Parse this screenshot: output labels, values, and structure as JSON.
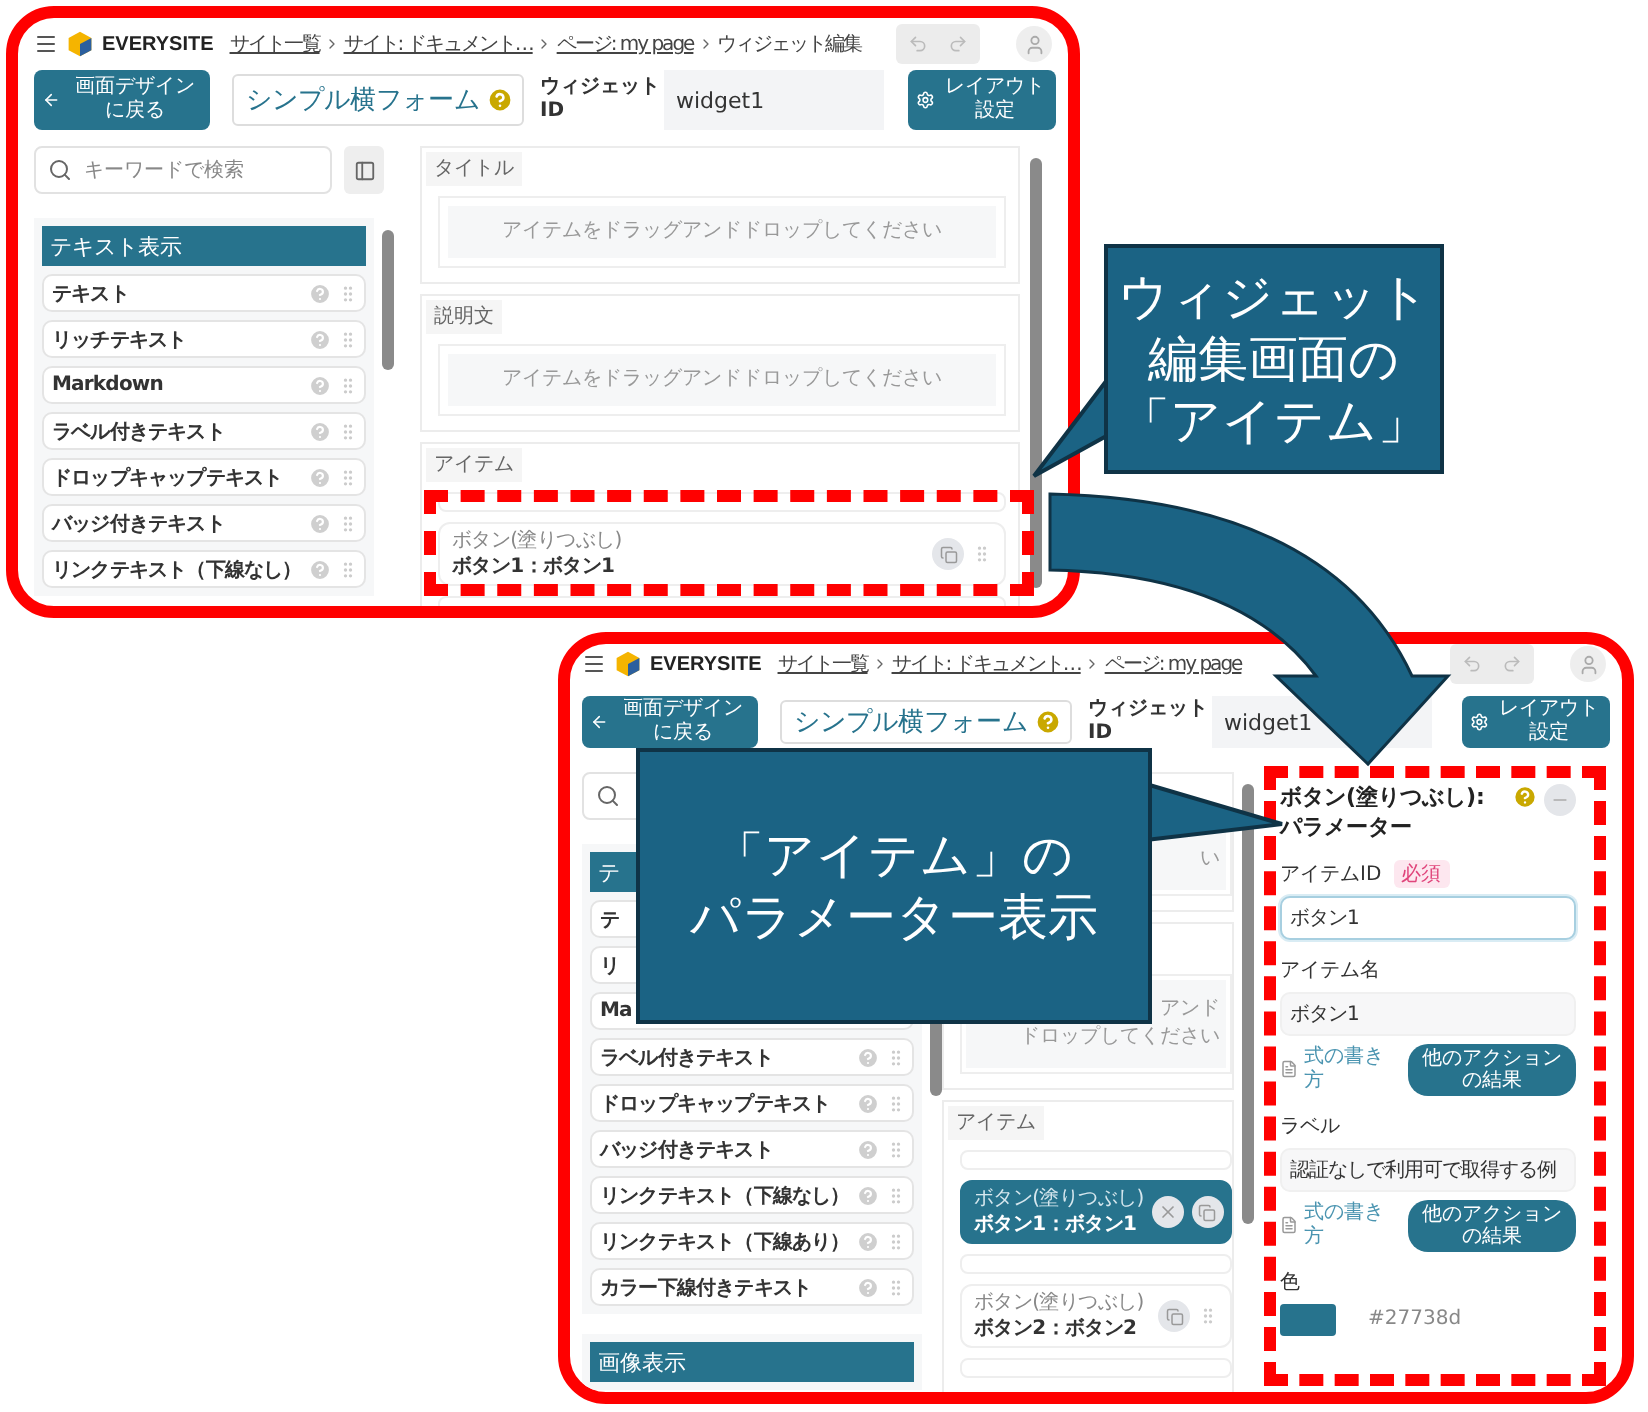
{
  "screens": [
    {
      "header": {
        "logo": "EVERYSITE",
        "breadcrumbs": [
          {
            "label": "サイト一覧",
            "link": true
          },
          {
            "label": "サイト: ドキュメント…",
            "link": true
          },
          {
            "label": "ページ: my page",
            "link": true
          },
          {
            "label": "ウィジェット編集",
            "link": false
          }
        ]
      },
      "toolbar": {
        "back_button": "画面デザインに戻る",
        "title_field": "シンプル横フォーム",
        "widget_id_label": "ウィジェットID",
        "widget_id_value": "widget1",
        "layout_button": "レイアウト設定"
      },
      "sidebar": {
        "search_placeholder": "キーワードで検索",
        "groups": [
          {
            "title": "テキスト表示",
            "items": [
              "テキスト",
              "リッチテキスト",
              "Markdown",
              "ラベル付きテキスト",
              "ドロップキャップテキスト",
              "バッジ付きテキスト",
              "リンクテキスト（下線なし）"
            ]
          }
        ]
      },
      "canvas": {
        "sections": [
          {
            "label": "タイトル",
            "drop_hint_lines": [
              "アイテムをドラッグアンドドロップしてください"
            ]
          },
          {
            "label": "説明文",
            "drop_hint_lines": [
              "アイテムをドラッグアンドドロップしてください"
            ]
          },
          {
            "label": "アイテム",
            "items": [
              {
                "type": "ボタン(塗りつぶし)",
                "name": "ボタン1：ボタン1",
                "selected": false
              }
            ]
          }
        ]
      }
    },
    {
      "header": {
        "logo": "EVERYSITE",
        "breadcrumbs": [
          {
            "label": "サイト一覧",
            "link": true
          },
          {
            "label": "サイト: ドキュメント…",
            "link": true
          },
          {
            "label": "ページ: my page",
            "link": true
          }
        ]
      },
      "toolbar": {
        "back_button": "画面デザインに戻る",
        "title_field": "シンプル横フォーム",
        "widget_id_label": "ウィジェットID",
        "widget_id_value": "widget1",
        "layout_button": "レイアウト設定"
      },
      "sidebar": {
        "groups": [
          {
            "title": "テ",
            "items": [
              "テ",
              "リ",
              "Ma",
              "ラベル付きテキスト",
              "ドロップキャップテキスト",
              "バッジ付きテキスト",
              "リンクテキスト（下線なし）",
              "リンクテキスト（下線あり）",
              "カラー下線付きテキスト"
            ]
          },
          {
            "title": "画像表示"
          }
        ]
      },
      "canvas": {
        "sections": [
          {
            "drop_hint_lines": [
              "い"
            ]
          },
          {
            "drop_hint_lines": [
              "アンド",
              "ドロップしてください"
            ]
          },
          {
            "label": "アイテム",
            "items": [
              {
                "type": "ボタン(塗りつぶし)",
                "name": "ボタン1：ボタン1",
                "selected": true
              },
              {
                "type": "ボタン(塗りつぶし)",
                "name": "ボタン2：ボタン2",
                "selected": false
              }
            ]
          }
        ]
      },
      "parameter_panel": {
        "title": "ボタン(塗りつぶし): パラメーター",
        "fields": [
          {
            "label": "アイテムID",
            "required_badge": "必須",
            "value": "ボタン1",
            "focused": true
          },
          {
            "label": "アイテム名",
            "value": "ボタン1",
            "focused": false,
            "formula_link": "式の書き方",
            "action_button": "他のアクションの結果"
          },
          {
            "label": "ラベル",
            "value": "認証なしで利用可で取得する例",
            "focused": false,
            "formula_link": "式の書き方",
            "action_button": "他のアクションの結果"
          }
        ],
        "color": {
          "label": "色",
          "value": "#27738d"
        }
      }
    }
  ],
  "callouts": [
    {
      "lines": [
        "ウィジェット",
        "編集画面の",
        "「アイテム」"
      ]
    },
    {
      "lines": [
        "「アイテム」の",
        "パラメーター表示"
      ]
    }
  ]
}
